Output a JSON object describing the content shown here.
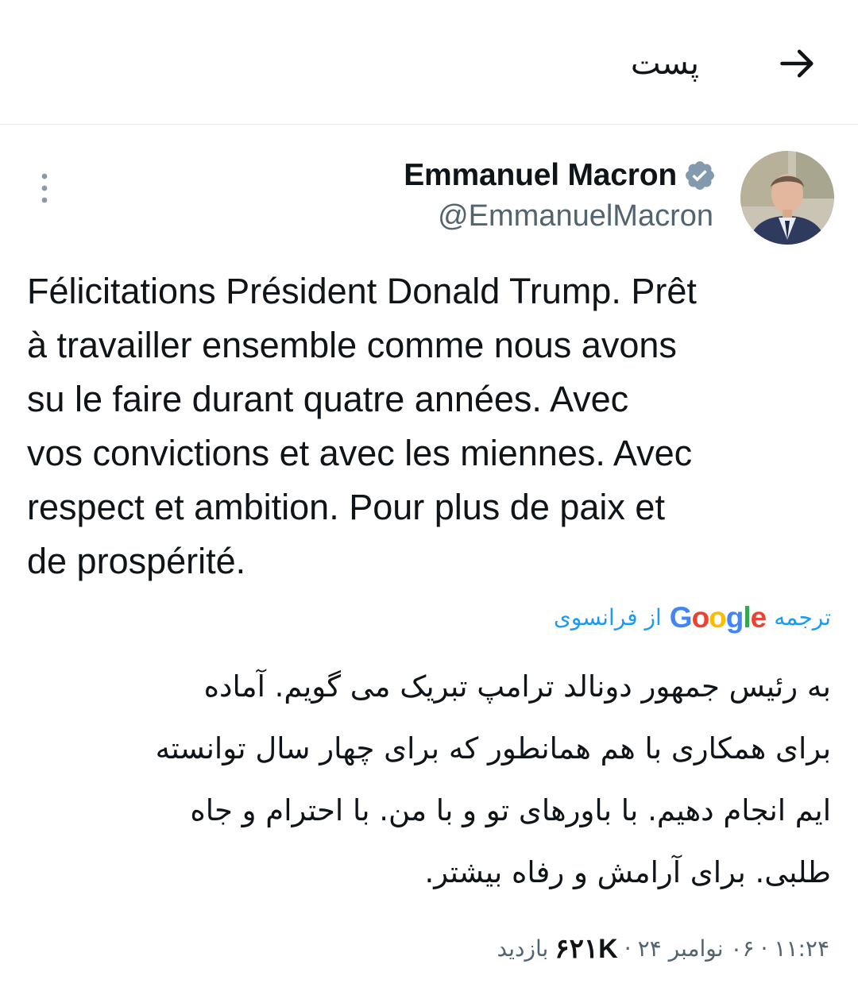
{
  "header": {
    "title": "پست"
  },
  "author": {
    "name": "Emmanuel Macron",
    "handle": "@EmmanuelMacron",
    "verified": true
  },
  "tweet": {
    "text": "Félicitations Président Donald Trump. Prêt\nà travailler ensemble comme nous avons\nsu le faire durant quatre années. Avec\nvos convictions et avec les miennes. Avec\nrespect et ambition. Pour plus de paix et\nde prospérité."
  },
  "translation": {
    "label": "ترجمه",
    "provider": "Google",
    "from": "از فرانسوی",
    "text": "به رئیس جمهور دونالد ترامپ تبریک می گویم. آماده\nبرای همکاری با هم همانطور که برای چهار سال توانسته\nایم انجام دهیم. با باورهای تو و با من. با احترام و جاه\nطلبی. برای آرامش و رفاه بیشتر."
  },
  "meta": {
    "time": "۱۱:۲۴",
    "date": "۰۶ نوامبر ۲۴",
    "separator": "·",
    "views_count": "۶۲۱K",
    "views_label": "بازدید"
  },
  "colors": {
    "accent": "#1d9bf0",
    "text": "#0f1419",
    "muted": "#536471",
    "verified": "#829aab",
    "divider": "#e6e9eb"
  },
  "icons": {
    "back": "arrow-right-icon",
    "verified": "verified-badge-icon",
    "more": "more-vertical-icon"
  }
}
